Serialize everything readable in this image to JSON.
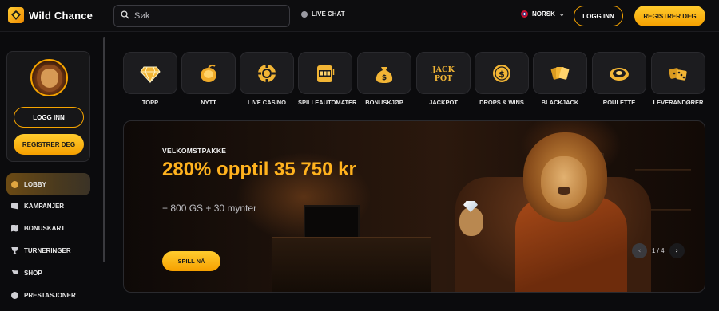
{
  "header": {
    "brand": "Wild Chance",
    "search_placeholder": "Søk",
    "live_chat": "LIVE CHAT",
    "language": "NORSK",
    "login": "LOGG INN",
    "register": "REGISTRER DEG"
  },
  "sidebar": {
    "login": "LOGG INN",
    "register": "REGISTRER DEG",
    "items": [
      {
        "label": "LOBBY",
        "icon": "lobby-icon",
        "active": true
      },
      {
        "label": "KAMPANJER",
        "icon": "megaphone-icon"
      },
      {
        "label": "BONUSKART",
        "icon": "map-icon"
      },
      {
        "label": "TURNERINGER",
        "icon": "trophy-icon"
      },
      {
        "label": "SHOP",
        "icon": "cart-icon"
      },
      {
        "label": "PRESTASJONER",
        "icon": "medal-icon"
      }
    ]
  },
  "categories": [
    {
      "label": "TOPP",
      "icon": "diamond-icon"
    },
    {
      "label": "NYTT",
      "icon": "coconut-icon"
    },
    {
      "label": "LIVE CASINO",
      "icon": "poker-chip-icon"
    },
    {
      "label": "SPILLEAUTOMATER",
      "icon": "slot-machine-icon"
    },
    {
      "label": "BONUSKJØP",
      "icon": "money-bag-icon"
    },
    {
      "label": "JACKPOT",
      "icon": "jackpot-icon",
      "icon_text": [
        "JACK",
        "POT"
      ]
    },
    {
      "label": "DROPS & WINS",
      "icon": "coin-icon"
    },
    {
      "label": "BLACKJACK",
      "icon": "cards-icon"
    },
    {
      "label": "ROULETTE",
      "icon": "roulette-icon"
    },
    {
      "label": "LEVERANDØRER",
      "icon": "dice-icon"
    }
  ],
  "banner": {
    "eyebrow": "VELKOMSTPAKKE",
    "title": "280% opptil 35 750 kr",
    "subtitle": "+ 800 GS + 30 mynter",
    "cta": "SPILL NÅ",
    "pager": "1 / 4"
  },
  "colors": {
    "accent": "#f6a400",
    "title": "#ffb21e",
    "background": "#0b0b0d"
  }
}
